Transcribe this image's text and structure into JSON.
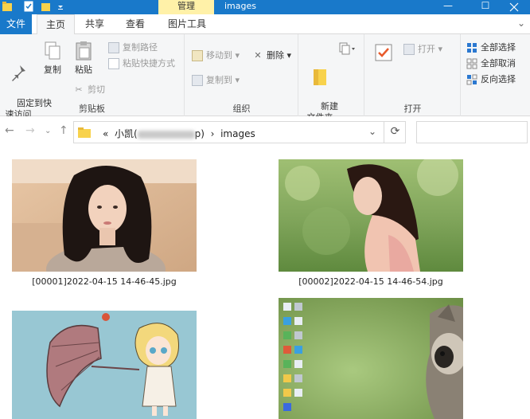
{
  "titlebar": {
    "context_tab": "管理",
    "title": "images",
    "minimize": "—",
    "maximize": "☐"
  },
  "tabs": {
    "file": "文件",
    "home": "主页",
    "share": "共享",
    "view": "查看",
    "picture_tools": "图片工具"
  },
  "ribbon": {
    "clipboard": {
      "label": "剪贴板",
      "pin": "固定到快\n速访问",
      "copy": "复制",
      "paste": "粘贴",
      "copy_path": "复制路径",
      "paste_shortcut": "粘贴快捷方式",
      "cut": "剪切"
    },
    "organize": {
      "label": "组织",
      "move_to": "移动到",
      "copy_to": "复制到",
      "delete": "删除"
    },
    "new": {
      "new_folder": "新建\n文件夹"
    },
    "open": {
      "label": "打开",
      "open": "打开"
    },
    "select": {
      "select_all": "全部选择",
      "select_none": "全部取消",
      "invert": "反向选择"
    }
  },
  "address": {
    "prefix": "«",
    "folder_start": "小凯(",
    "folder_end": "p)",
    "sep": "›",
    "current": "images"
  },
  "files": [
    {
      "name": "[00001]2022-04-15 14-46-45.jpg"
    },
    {
      "name": "[00002]2022-04-15 14-46-54.jpg"
    }
  ],
  "colors": {
    "accent": "#1979ca",
    "context_tab": "#fff1a8",
    "ribbon_bg": "#f5f6f7"
  }
}
